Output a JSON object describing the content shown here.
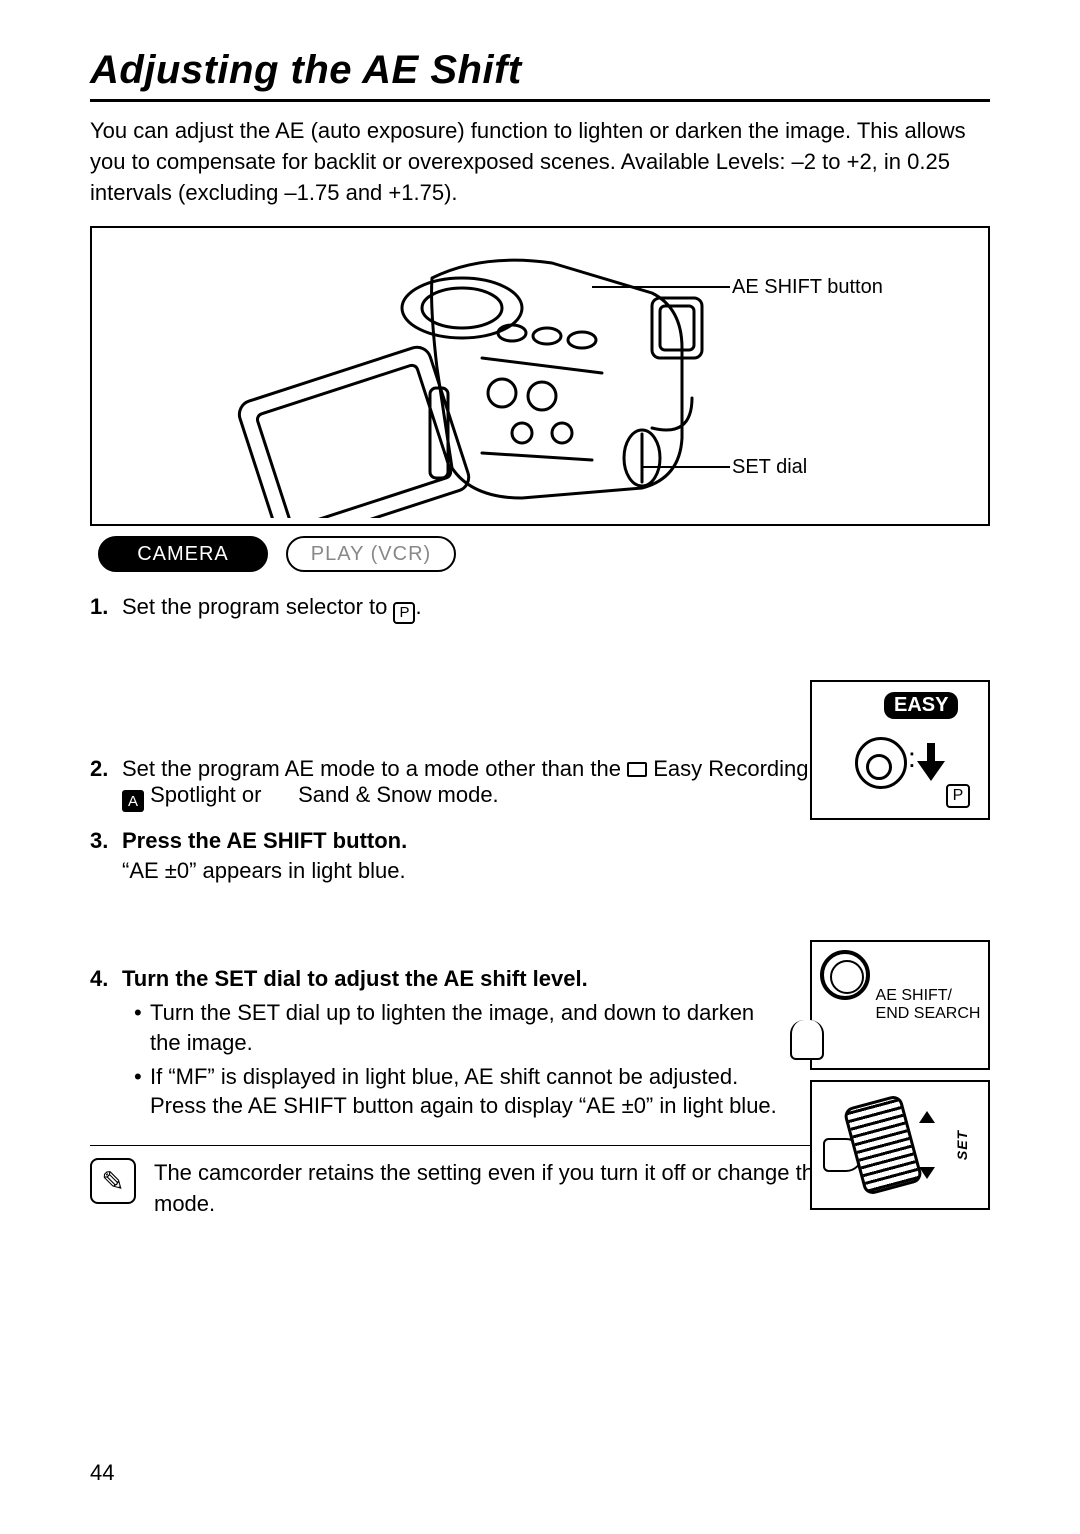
{
  "title": "Adjusting the AE Shift",
  "intro": "You can adjust the AE (auto exposure) function to lighten or darken the image. This allows you to compensate for backlit or overexposed scenes. Available Levels: –2 to +2, in 0.25 intervals (excluding –1.75 and +1.75).",
  "callouts": {
    "ae_shift_button": "AE SHIFT button",
    "set_dial": "SET dial"
  },
  "modes": {
    "camera": "CAMERA",
    "play": "PLAY (VCR)"
  },
  "steps": {
    "s1_num": "1.",
    "s1_text_a": "Set the program selector to ",
    "s1_text_b": ".",
    "s2_num": "2.",
    "s2_text_a": "Set the program AE mode to a mode other than the ",
    "s2_text_b": "Easy Recording, ",
    "s2_text_c": "Spotlight or ",
    "s2_text_d": "Sand & Snow mode.",
    "s3_num": "3.",
    "s3_head": "Press the AE SHIFT button.",
    "s3_sub": "“AE ±0” appears in light blue.",
    "s4_num": "4.",
    "s4_head": "Turn the SET dial to adjust the AE shift level.",
    "s4_b1": "Turn the SET dial up to lighten the image, and down to darken the image.",
    "s4_b2": "If “MF” is displayed in light blue, AE shift cannot be adjusted. Press the AE SHIFT button again to display “AE ±0” in light blue."
  },
  "easy_badge": "EASY",
  "p_char": "P",
  "btn_fig": {
    "line1": "AE SHIFT/",
    "line2": "END SEARCH"
  },
  "dial_label": "SET",
  "note": "The camcorder retains the setting even if you turn it off or change the program AE mode.",
  "page_number": "44",
  "spot_char": "A"
}
